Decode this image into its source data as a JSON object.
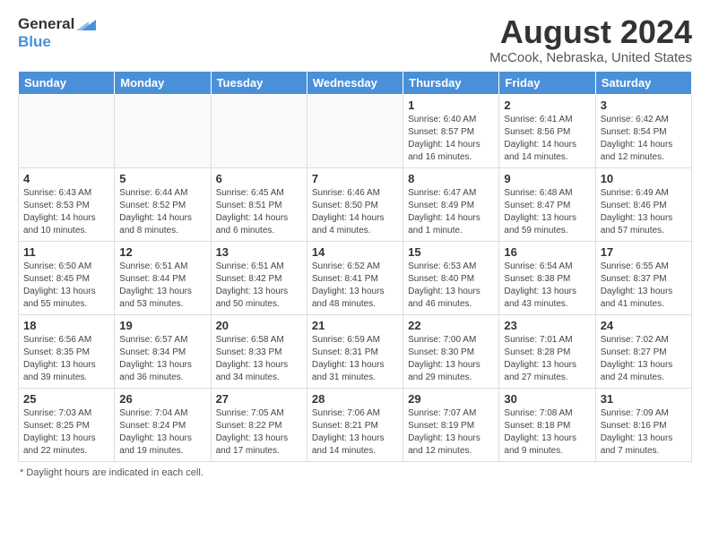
{
  "header": {
    "logo_general": "General",
    "logo_blue": "Blue",
    "title": "August 2024",
    "subtitle": "McCook, Nebraska, United States"
  },
  "days_of_week": [
    "Sunday",
    "Monday",
    "Tuesday",
    "Wednesday",
    "Thursday",
    "Friday",
    "Saturday"
  ],
  "footer": {
    "note": "Daylight hours"
  },
  "weeks": [
    [
      {
        "day": "",
        "info": ""
      },
      {
        "day": "",
        "info": ""
      },
      {
        "day": "",
        "info": ""
      },
      {
        "day": "",
        "info": ""
      },
      {
        "day": "1",
        "info": "Sunrise: 6:40 AM\nSunset: 8:57 PM\nDaylight: 14 hours\nand 16 minutes."
      },
      {
        "day": "2",
        "info": "Sunrise: 6:41 AM\nSunset: 8:56 PM\nDaylight: 14 hours\nand 14 minutes."
      },
      {
        "day": "3",
        "info": "Sunrise: 6:42 AM\nSunset: 8:54 PM\nDaylight: 14 hours\nand 12 minutes."
      }
    ],
    [
      {
        "day": "4",
        "info": "Sunrise: 6:43 AM\nSunset: 8:53 PM\nDaylight: 14 hours\nand 10 minutes."
      },
      {
        "day": "5",
        "info": "Sunrise: 6:44 AM\nSunset: 8:52 PM\nDaylight: 14 hours\nand 8 minutes."
      },
      {
        "day": "6",
        "info": "Sunrise: 6:45 AM\nSunset: 8:51 PM\nDaylight: 14 hours\nand 6 minutes."
      },
      {
        "day": "7",
        "info": "Sunrise: 6:46 AM\nSunset: 8:50 PM\nDaylight: 14 hours\nand 4 minutes."
      },
      {
        "day": "8",
        "info": "Sunrise: 6:47 AM\nSunset: 8:49 PM\nDaylight: 14 hours\nand 1 minute."
      },
      {
        "day": "9",
        "info": "Sunrise: 6:48 AM\nSunset: 8:47 PM\nDaylight: 13 hours\nand 59 minutes."
      },
      {
        "day": "10",
        "info": "Sunrise: 6:49 AM\nSunset: 8:46 PM\nDaylight: 13 hours\nand 57 minutes."
      }
    ],
    [
      {
        "day": "11",
        "info": "Sunrise: 6:50 AM\nSunset: 8:45 PM\nDaylight: 13 hours\nand 55 minutes."
      },
      {
        "day": "12",
        "info": "Sunrise: 6:51 AM\nSunset: 8:44 PM\nDaylight: 13 hours\nand 53 minutes."
      },
      {
        "day": "13",
        "info": "Sunrise: 6:51 AM\nSunset: 8:42 PM\nDaylight: 13 hours\nand 50 minutes."
      },
      {
        "day": "14",
        "info": "Sunrise: 6:52 AM\nSunset: 8:41 PM\nDaylight: 13 hours\nand 48 minutes."
      },
      {
        "day": "15",
        "info": "Sunrise: 6:53 AM\nSunset: 8:40 PM\nDaylight: 13 hours\nand 46 minutes."
      },
      {
        "day": "16",
        "info": "Sunrise: 6:54 AM\nSunset: 8:38 PM\nDaylight: 13 hours\nand 43 minutes."
      },
      {
        "day": "17",
        "info": "Sunrise: 6:55 AM\nSunset: 8:37 PM\nDaylight: 13 hours\nand 41 minutes."
      }
    ],
    [
      {
        "day": "18",
        "info": "Sunrise: 6:56 AM\nSunset: 8:35 PM\nDaylight: 13 hours\nand 39 minutes."
      },
      {
        "day": "19",
        "info": "Sunrise: 6:57 AM\nSunset: 8:34 PM\nDaylight: 13 hours\nand 36 minutes."
      },
      {
        "day": "20",
        "info": "Sunrise: 6:58 AM\nSunset: 8:33 PM\nDaylight: 13 hours\nand 34 minutes."
      },
      {
        "day": "21",
        "info": "Sunrise: 6:59 AM\nSunset: 8:31 PM\nDaylight: 13 hours\nand 31 minutes."
      },
      {
        "day": "22",
        "info": "Sunrise: 7:00 AM\nSunset: 8:30 PM\nDaylight: 13 hours\nand 29 minutes."
      },
      {
        "day": "23",
        "info": "Sunrise: 7:01 AM\nSunset: 8:28 PM\nDaylight: 13 hours\nand 27 minutes."
      },
      {
        "day": "24",
        "info": "Sunrise: 7:02 AM\nSunset: 8:27 PM\nDaylight: 13 hours\nand 24 minutes."
      }
    ],
    [
      {
        "day": "25",
        "info": "Sunrise: 7:03 AM\nSunset: 8:25 PM\nDaylight: 13 hours\nand 22 minutes."
      },
      {
        "day": "26",
        "info": "Sunrise: 7:04 AM\nSunset: 8:24 PM\nDaylight: 13 hours\nand 19 minutes."
      },
      {
        "day": "27",
        "info": "Sunrise: 7:05 AM\nSunset: 8:22 PM\nDaylight: 13 hours\nand 17 minutes."
      },
      {
        "day": "28",
        "info": "Sunrise: 7:06 AM\nSunset: 8:21 PM\nDaylight: 13 hours\nand 14 minutes."
      },
      {
        "day": "29",
        "info": "Sunrise: 7:07 AM\nSunset: 8:19 PM\nDaylight: 13 hours\nand 12 minutes."
      },
      {
        "day": "30",
        "info": "Sunrise: 7:08 AM\nSunset: 8:18 PM\nDaylight: 13 hours\nand 9 minutes."
      },
      {
        "day": "31",
        "info": "Sunrise: 7:09 AM\nSunset: 8:16 PM\nDaylight: 13 hours\nand 7 minutes."
      }
    ]
  ]
}
